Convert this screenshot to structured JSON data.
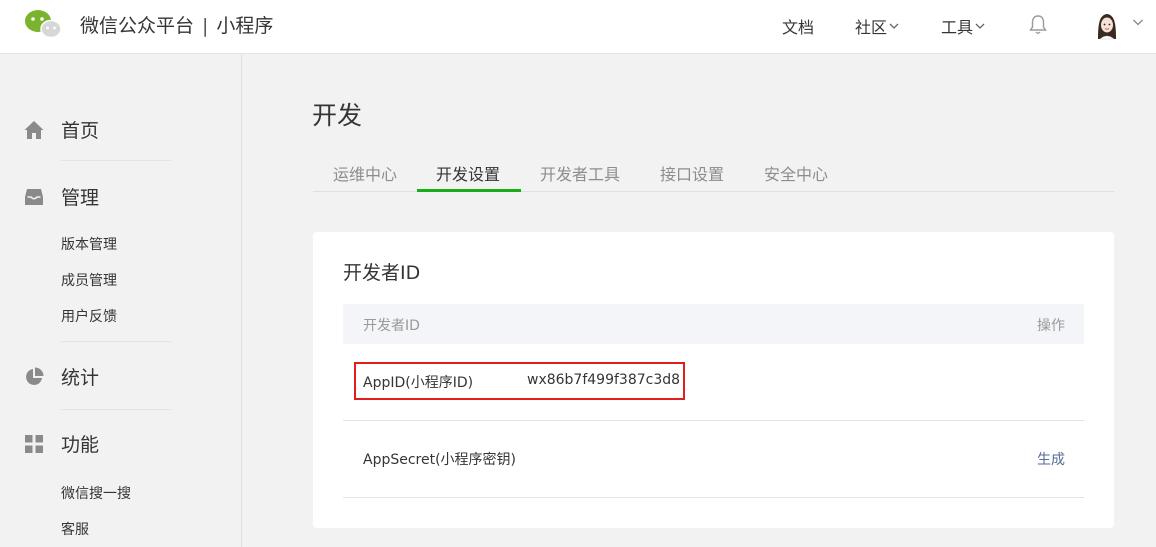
{
  "header": {
    "brand": "微信公众平台",
    "separator": "|",
    "product": "小程序",
    "nav": {
      "docs": "文档",
      "community": "社区",
      "tools": "工具"
    },
    "icons": {
      "logo": "wechat-logo-icon",
      "bell": "bell-icon",
      "avatar": "user-avatar",
      "chevron": "chevron-down-icon"
    },
    "brand_color": "#7bb32e"
  },
  "sidebar": {
    "home": "首页",
    "manage": "管理",
    "manage_items": [
      "版本管理",
      "成员管理",
      "用户反馈"
    ],
    "stats": "统计",
    "features": "功能",
    "feature_items": [
      "微信搜一搜",
      "客服"
    ]
  },
  "main": {
    "title": "开发",
    "tabs": [
      {
        "label": "运维中心",
        "active": false
      },
      {
        "label": "开发设置",
        "active": true
      },
      {
        "label": "开发者工具",
        "active": false
      },
      {
        "label": "接口设置",
        "active": false
      },
      {
        "label": "安全中心",
        "active": false
      }
    ],
    "accent_color": "#1aad19",
    "card": {
      "title": "开发者ID",
      "columns": {
        "name": "开发者ID",
        "action": "操作"
      },
      "rows": [
        {
          "key": "AppID(小程序ID)",
          "value": "wx86b7f499f387c3d8",
          "action": ""
        },
        {
          "key": "AppSecret(小程序密钥)",
          "value": "",
          "action": "生成"
        }
      ],
      "highlight_color": "#e01e1e"
    }
  }
}
